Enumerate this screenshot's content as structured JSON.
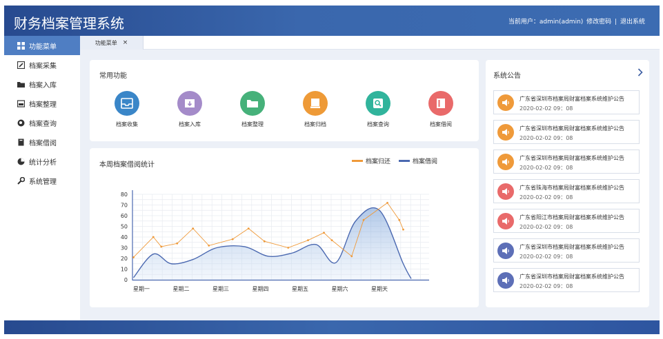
{
  "header": {
    "title": "财务档案管理系统",
    "user_label": "当前用户：admin(admin)",
    "change_password": "修改密码",
    "separator": "|",
    "logout": "退出系统"
  },
  "sidebar": {
    "items": [
      {
        "label": "功能菜单",
        "icon": "grid-icon",
        "active": true
      },
      {
        "label": "档案采集",
        "icon": "edit-icon"
      },
      {
        "label": "档案入库",
        "icon": "folder-icon"
      },
      {
        "label": "档案整理",
        "icon": "tray-icon"
      },
      {
        "label": "档案查询",
        "icon": "search-icon"
      },
      {
        "label": "档案借阅",
        "icon": "book-icon"
      },
      {
        "label": "统计分析",
        "icon": "pie-chart-icon"
      },
      {
        "label": "系统管理",
        "icon": "wrench-icon"
      }
    ]
  },
  "tabs": [
    {
      "label": "功能菜单",
      "close": "×"
    }
  ],
  "quick_functions": {
    "title": "常用功能",
    "items": [
      {
        "label": "档案收集",
        "icon": "inbox-icon",
        "color": "#3a86c8"
      },
      {
        "label": "档案入库",
        "icon": "archive-box-icon",
        "color": "#a48bc9"
      },
      {
        "label": "档案整理",
        "icon": "folder-open-icon",
        "color": "#46b17a"
      },
      {
        "label": "档案归档",
        "icon": "file-stack-icon",
        "color": "#ee9a37"
      },
      {
        "label": "档案查询",
        "icon": "search-icon",
        "color": "#31b49c"
      },
      {
        "label": "档案借阅",
        "icon": "book-icon",
        "color": "#e96a6a"
      }
    ]
  },
  "chart_panel": {
    "title": "本周档案借阅统计"
  },
  "chart_data": {
    "type": "line",
    "categories": [
      "星期一",
      "星期二",
      "星期三",
      "星期四",
      "星期五",
      "星期六",
      "星期天"
    ],
    "ylim": [
      0,
      80
    ],
    "yticks": [
      0,
      10,
      20,
      30,
      40,
      50,
      60,
      70,
      80
    ],
    "grid": true,
    "legend_position": "top-right",
    "series": [
      {
        "name": "档案归还",
        "color": "#ef9a3a",
        "x": [
          -0.2,
          0.3,
          0.5,
          0.9,
          1.3,
          1.7,
          2.3,
          2.7,
          3.1,
          3.7,
          4.2,
          4.6,
          4.8,
          5.3,
          5.6,
          6.2,
          6.5,
          6.6
        ],
        "values": [
          21,
          40,
          31,
          34,
          48,
          32,
          38,
          48,
          36,
          30,
          37,
          44,
          37,
          22,
          56,
          72,
          56,
          47
        ]
      },
      {
        "name": "档案借阅",
        "color": "#4a68b0",
        "smooth": true,
        "area": true,
        "x": [
          -0.2,
          0.3,
          0.75,
          1.3,
          1.9,
          2.6,
          3.2,
          3.8,
          4.4,
          4.9,
          5.4,
          6.0,
          6.6,
          6.8
        ],
        "values": [
          2,
          24,
          15,
          19,
          30,
          31,
          22,
          25,
          33,
          16,
          55,
          65,
          15,
          1
        ]
      }
    ]
  },
  "notices": {
    "title": "系统公告",
    "more_icon": "chevron-right-icon",
    "items": [
      {
        "text": "广东省深圳市档案局财富档案系统维护公告",
        "time": "2020-02-02   09：08",
        "color": "#ef9a3a",
        "icon": "megaphone-icon"
      },
      {
        "text": "广东省深圳市档案局财富档案系统维护公告",
        "time": "2020-02-02   09：08",
        "color": "#ef9a3a",
        "icon": "megaphone-icon"
      },
      {
        "text": "广东省深圳市档案局财富档案系统维护公告",
        "time": "2020-02-02   09：08",
        "color": "#ef9a3a",
        "icon": "megaphone-icon"
      },
      {
        "text": "广东省珠海市档案局财富档案系统维护公告",
        "time": "2020-02-02   09：08",
        "color": "#e96a6a",
        "icon": "megaphone-icon"
      },
      {
        "text": "广东省阳江市档案局财富档案系统维护公告",
        "time": "2020-02-02   09：08",
        "color": "#e96a6a",
        "icon": "megaphone-icon"
      },
      {
        "text": "广东省深圳市档案局财富档案系统维护公告",
        "time": "2020-02-02   09：08",
        "color": "#5d6fb7",
        "icon": "megaphone-icon"
      },
      {
        "text": "广东省深圳市档案局财富档案系统维护公告",
        "time": "2020-02-02   09：08",
        "color": "#5d6fb7",
        "icon": "megaphone-icon"
      }
    ]
  }
}
